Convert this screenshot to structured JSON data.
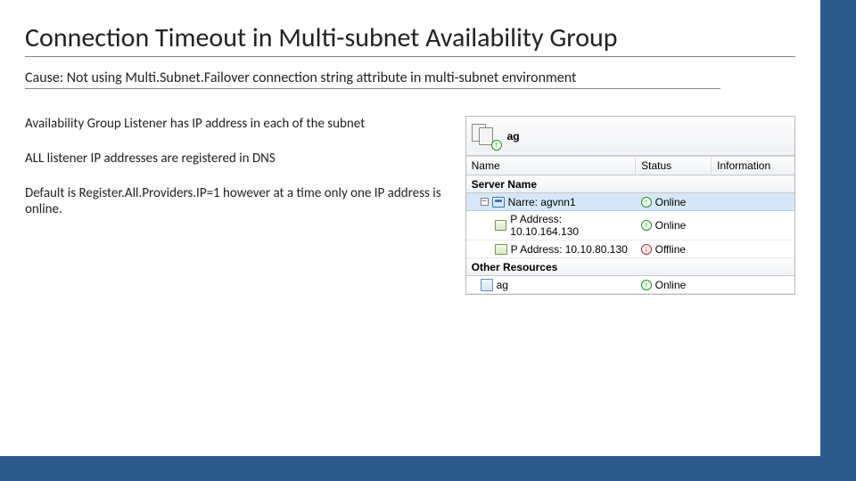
{
  "title": "Connection Timeout in Multi-subnet  Availability Group",
  "cause": "Cause: Not using Multi.Subnet.Failover connection string attribute in multi-subnet environment",
  "body": {
    "p1": "Availability Group Listener has IP address in each of the subnet",
    "p2": "ALL listener IP addresses are registered in DNS",
    "p3": "Default is Register.All.Providers.IP=1 however at a time only one IP address is online."
  },
  "panel": {
    "ag_label": "ag",
    "columns": {
      "name": "Name",
      "status": "Status",
      "info": "Information"
    },
    "section_server": "Server Name",
    "section_other": "Other Resources",
    "rows": {
      "server_name": "Narre: agvnn1",
      "ip1": "P Address: 10.10.164.130",
      "ip2": "P Address: 10.10.80.130",
      "resource": "ag"
    },
    "status": {
      "online": "Online",
      "offline": "Offline"
    },
    "tree_toggle": "−"
  }
}
